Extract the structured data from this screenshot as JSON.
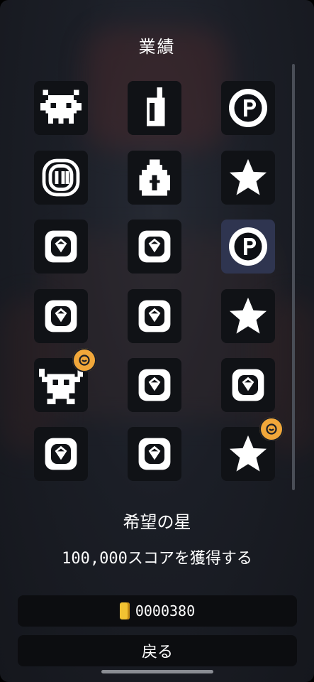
{
  "title": "業績",
  "achievements": [
    {
      "icon": "monster-icon",
      "selected": false,
      "badge": false
    },
    {
      "icon": "battery-icon",
      "selected": false,
      "badge": false
    },
    {
      "icon": "p-coin-icon",
      "selected": false,
      "badge": false
    },
    {
      "icon": "ring-coin-icon",
      "selected": false,
      "badge": false
    },
    {
      "icon": "money-bag-icon",
      "selected": false,
      "badge": false
    },
    {
      "icon": "star-icon",
      "selected": false,
      "badge": false
    },
    {
      "icon": "locked-gem-icon",
      "selected": false,
      "badge": false
    },
    {
      "icon": "locked-gem-icon",
      "selected": false,
      "badge": false
    },
    {
      "icon": "p-coin-icon",
      "selected": true,
      "badge": false
    },
    {
      "icon": "locked-gem-icon",
      "selected": false,
      "badge": false
    },
    {
      "icon": "locked-gem-icon",
      "selected": false,
      "badge": false
    },
    {
      "icon": "star-icon",
      "selected": false,
      "badge": false
    },
    {
      "icon": "horned-creature-icon",
      "selected": false,
      "badge": true
    },
    {
      "icon": "locked-gem-icon",
      "selected": false,
      "badge": false
    },
    {
      "icon": "locked-gem-icon",
      "selected": false,
      "badge": false
    },
    {
      "icon": "locked-gem-icon",
      "selected": false,
      "badge": false
    },
    {
      "icon": "locked-gem-icon",
      "selected": false,
      "badge": false
    },
    {
      "icon": "star-icon",
      "selected": false,
      "badge": true
    }
  ],
  "selected_achievement": {
    "name": "希望の星",
    "description": "100,000スコアを獲得する"
  },
  "coins": {
    "value": "0000380"
  },
  "back_label": "戻る",
  "colors": {
    "badge": "#f1a73a",
    "selected_cell": "#2f3550",
    "coin": "#f1c232"
  }
}
